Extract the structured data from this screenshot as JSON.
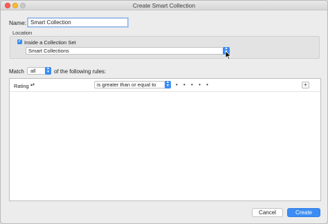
{
  "window": {
    "title": "Create Smart Collection"
  },
  "name": {
    "label": "Name:",
    "value": "Smart Collection"
  },
  "location": {
    "group_label": "Location",
    "checkbox_label": "Inside a Collection Set",
    "checked": true,
    "collection_set": "Smart Collections"
  },
  "match": {
    "prefix": "Match",
    "selected": "all",
    "suffix": "of the following rules:"
  },
  "rules": [
    {
      "field": "Rating",
      "operator": "is greater than or equal to",
      "value_display": "• • • • •"
    }
  ],
  "buttons": {
    "cancel": "Cancel",
    "create": "Create"
  },
  "colors": {
    "accent": "#3b8df5"
  }
}
